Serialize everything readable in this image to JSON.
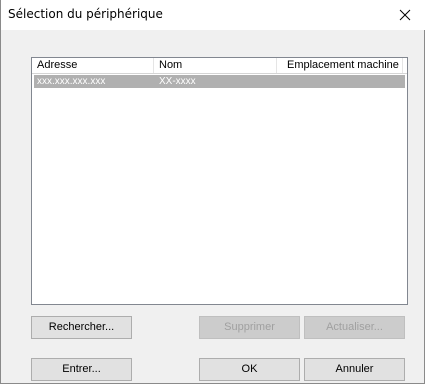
{
  "window": {
    "title": "Sélection du périphérique"
  },
  "list": {
    "columns": [
      "Adresse",
      "Nom",
      "Emplacement machine"
    ],
    "rows": [
      {
        "adresse": "xxx.xxx.xxx.xxx",
        "nom": "XX-xxxx",
        "emplacement": ""
      }
    ]
  },
  "buttons": {
    "rechercher": "Rechercher...",
    "supprimer": "Supprimer",
    "actualiser": "Actualiser...",
    "entrer": "Entrer...",
    "ok": "OK",
    "annuler": "Annuler"
  },
  "colors": {
    "selected_row": "#b0b0b0",
    "dialog_bg": "#f0f0f0"
  }
}
